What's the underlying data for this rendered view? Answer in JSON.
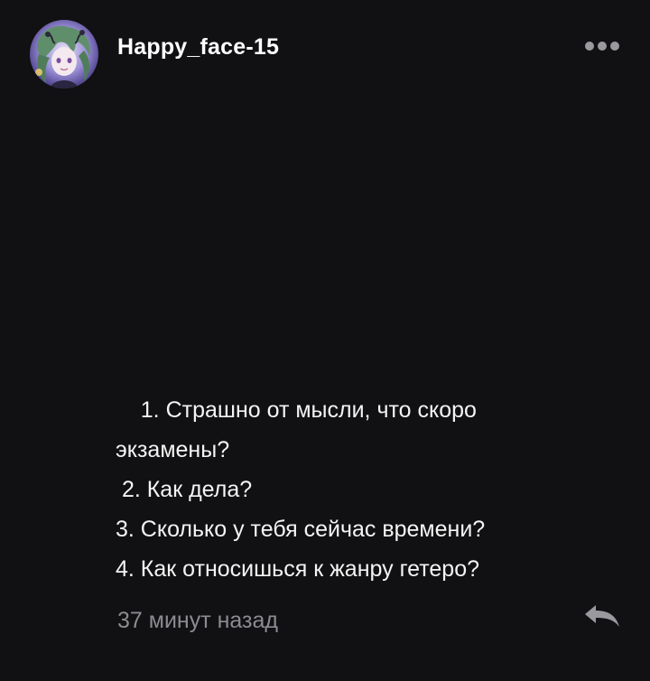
{
  "post": {
    "author": {
      "username": "Happy_face-15"
    },
    "more_icon": "more-dots-icon",
    "body_lines": [
      "    1. Страшно от мысли, что скоро",
      "экзамены?",
      " 2. Как дела?",
      "3. Сколько у тебя сейчас времени?",
      "4. Как относишься к жанру гетеро?"
    ],
    "timestamp": "37 минут назад",
    "reply_icon": "reply-arrow-icon"
  },
  "colors": {
    "background": "#111012",
    "text": "#f4f4f4",
    "muted": "#8c8c90",
    "icon": "#9a9a9e"
  }
}
